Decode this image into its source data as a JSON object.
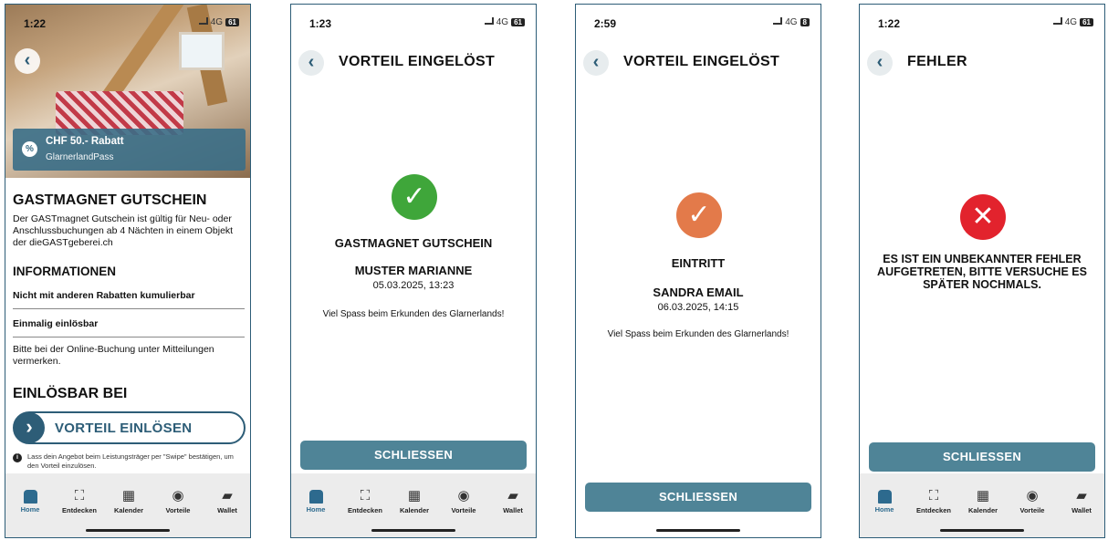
{
  "nav": {
    "home": "Home",
    "entdecken": "Entdecken",
    "kalender": "Kalender",
    "vorteile": "Vorteile",
    "wallet": "Wallet"
  },
  "screens": [
    {
      "time": "1:22",
      "signal": "4G",
      "battery": "61",
      "badge_title": "CHF 50.- Rabatt",
      "badge_subtitle": "GlarnerlandPass",
      "title": "GASTMAGNET GUTSCHEIN",
      "description": "Der GASTmagnet Gutschein ist gültig für Neu- oder Anschlussbuchungen ab 4 Nächten in einem Objekt der dieGASTgeberei.ch",
      "info_heading": "INFORMATIONEN",
      "info_1": "Nicht mit anderen Rabatten kumulierbar",
      "info_2": "Einmalig einlösbar",
      "note": "Bitte bei der Online-Buchung unter Mitteilungen vermerken.",
      "redeem_heading": "EINLÖSBAR BEI",
      "redeem_button": "VORTEIL EINLÖSEN",
      "hint": "Lass dein Angebot beim Leistungsträger per \"Swipe\" bestätigen, um den Vorteil einzulösen."
    },
    {
      "time": "1:23",
      "signal": "4G",
      "battery": "61",
      "title": "VORTEIL EINGELÖST",
      "item": "GASTMAGNET GUTSCHEIN",
      "name": "MUSTER MARIANNE",
      "date": "05.03.2025, 13:23",
      "message": "Viel Spass beim Erkunden des Glarnerlands!",
      "button": "SCHLIESSEN",
      "check_color": "#3fa63a"
    },
    {
      "time": "2:59",
      "signal": "4G",
      "battery": "8",
      "title": "VORTEIL EINGELÖST",
      "item": "EINTRITT",
      "name": "SANDRA EMAIL",
      "date": "06.03.2025, 14:15",
      "message": "Viel Spass beim Erkunden des Glarnerlands!",
      "button": "SCHLIESSEN",
      "check_color": "#e37a4a"
    },
    {
      "time": "1:22",
      "signal": "4G",
      "battery": "61",
      "title": "FEHLER",
      "error": "ES IST EIN UNBEKANNTER FEHLER AUFGETRETEN, BITTE VERSUCHE ES SPÄTER NOCHMALS.",
      "button": "SCHLIESSEN"
    }
  ]
}
